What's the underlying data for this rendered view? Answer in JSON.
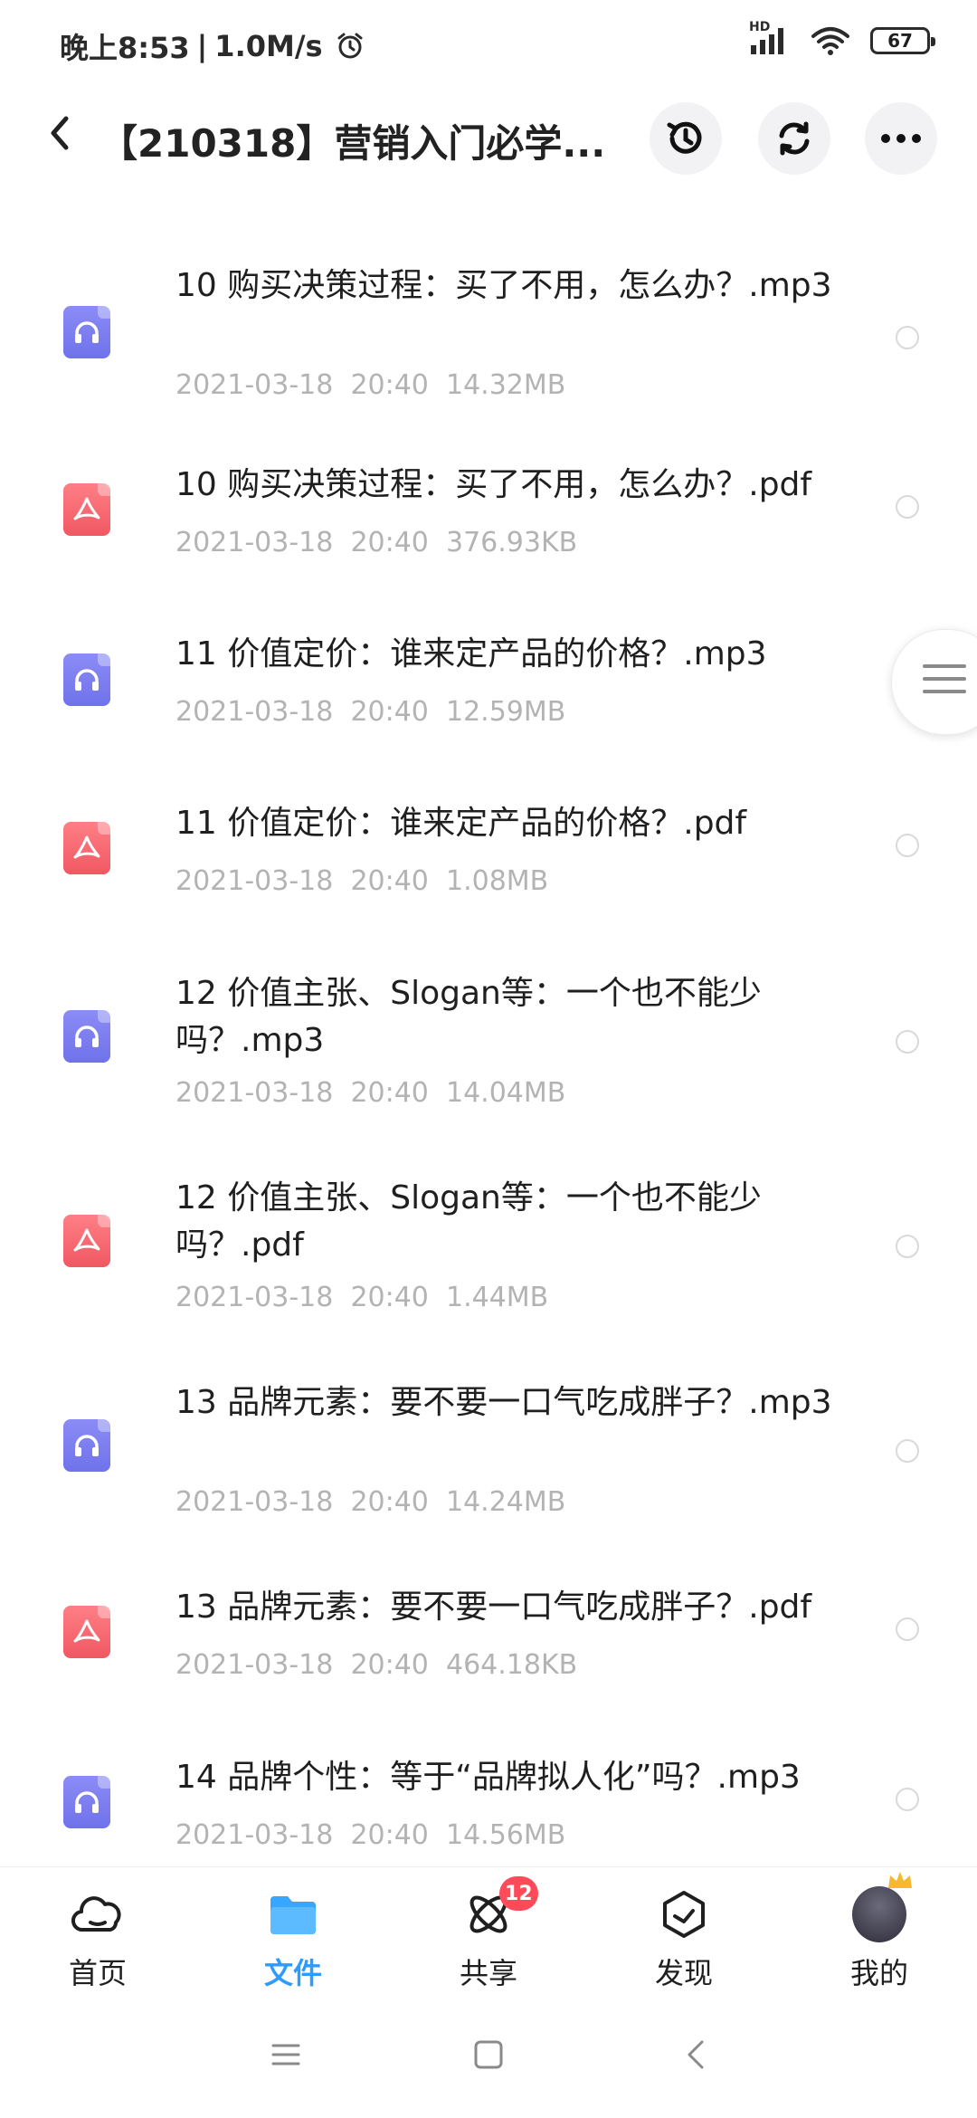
{
  "status_bar": {
    "time": "晚上8:53",
    "speed": "1.0M/s",
    "battery": "67",
    "network": "HD"
  },
  "header": {
    "title": "【210318】营销入门必学..."
  },
  "files": [
    {
      "name": "10 购买决策过程：买了不用，怎么办？.mp3",
      "date": "2021-03-18",
      "time": "20:40",
      "size": "14.32MB",
      "type": "audio"
    },
    {
      "name": "10 购买决策过程：买了不用，怎么办？.pdf",
      "date": "2021-03-18",
      "time": "20:40",
      "size": "376.93KB",
      "type": "pdf"
    },
    {
      "name": "11 价值定价：谁来定产品的价格？.mp3",
      "date": "2021-03-18",
      "time": "20:40",
      "size": "12.59MB",
      "type": "audio"
    },
    {
      "name": "11 价值定价：谁来定产品的价格？.pdf",
      "date": "2021-03-18",
      "time": "20:40",
      "size": "1.08MB",
      "type": "pdf"
    },
    {
      "name": "12 价值主张、Slogan等：一个也不能少吗？.mp3",
      "date": "2021-03-18",
      "time": "20:40",
      "size": "14.04MB",
      "type": "audio"
    },
    {
      "name": "12 价值主张、Slogan等：一个也不能少吗？.pdf",
      "date": "2021-03-18",
      "time": "20:40",
      "size": "1.44MB",
      "type": "pdf"
    },
    {
      "name": "13 品牌元素：要不要一口气吃成胖子？.mp3",
      "date": "2021-03-18",
      "time": "20:40",
      "size": "14.24MB",
      "type": "audio"
    },
    {
      "name": "13 品牌元素：要不要一口气吃成胖子？.pdf",
      "date": "2021-03-18",
      "time": "20:40",
      "size": "464.18KB",
      "type": "pdf"
    },
    {
      "name": "14 品牌个性：等于“品牌拟人化”吗？.mp3",
      "date": "2021-03-18",
      "time": "20:40",
      "size": "14.56MB",
      "type": "audio"
    }
  ],
  "bottom_nav": {
    "home": "首页",
    "files": "文件",
    "share": "共享",
    "share_badge": "12",
    "discover": "发现",
    "mine": "我的"
  },
  "colors": {
    "accent": "#2e9bff",
    "audio_icon": "#7b7ff0",
    "pdf_icon": "#f4646e",
    "badge": "#ff4a5a"
  }
}
